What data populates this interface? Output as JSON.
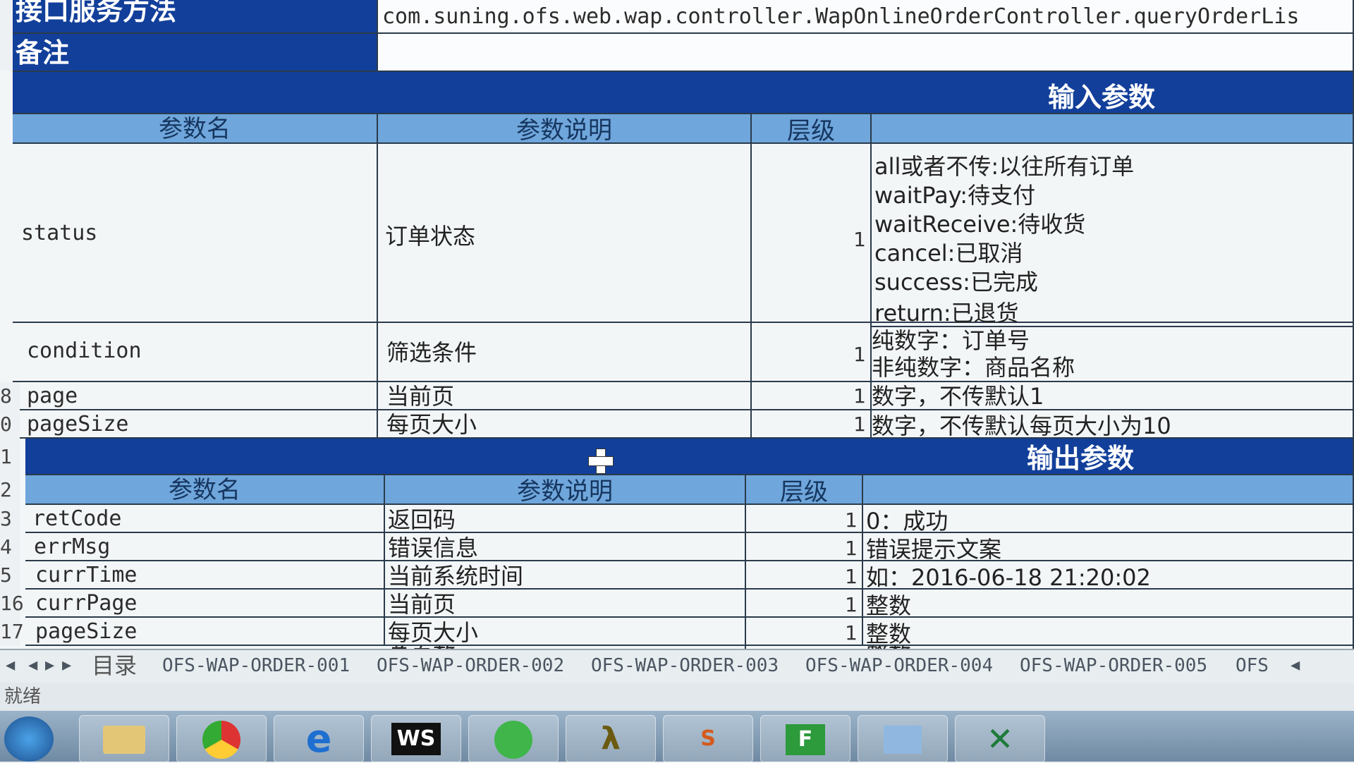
{
  "top": {
    "method_label": "接口服务方法",
    "method_value": "com.suning.ofs.web.wap.controller.WapOnlineOrderController.queryOrderLis",
    "remark_label": "备注"
  },
  "input_section": {
    "title": "输入参数",
    "headers": [
      "参数名",
      "参数说明",
      "层级",
      ""
    ],
    "rows": [
      {
        "rownum": "",
        "name": "status",
        "desc": "订单状态",
        "level": "1",
        "lines": [
          "all或者不传:以往所有订单",
          "waitPay:待支付",
          "waitReceive:待收货",
          "cancel:已取消",
          "success:已完成",
          "return:已退货"
        ]
      },
      {
        "rownum": "",
        "name": "condition",
        "desc": "筛选条件",
        "level": "1",
        "lines": [
          "纯数字：订单号",
          "非纯数字：商品名称"
        ]
      },
      {
        "rownum": "8",
        "name": "page",
        "desc": "当前页",
        "level": "1",
        "lines": [
          "数字，不传默认1"
        ]
      },
      {
        "rownum": "0",
        "name": "pageSize",
        "desc": "每页大小",
        "level": "1",
        "lines": [
          "数字，不传默认每页大小为10"
        ]
      }
    ]
  },
  "output_section": {
    "rownum": "1",
    "title": "输出参数",
    "header_rownum": "2",
    "headers": [
      "参数名",
      "参数说明",
      "层级",
      ""
    ],
    "rows": [
      {
        "rownum": "3",
        "name": "retCode",
        "desc": "返回码",
        "level": "1",
        "note": "0：成功"
      },
      {
        "rownum": "4",
        "name": "errMsg",
        "desc": "错误信息",
        "level": "1",
        "note": "错误提示文案"
      },
      {
        "rownum": "5",
        "name": "currTime",
        "desc": "当前系统时间",
        "level": "1",
        "note": "如：2016-06-18 21:20:02"
      },
      {
        "rownum": "16",
        "name": "currPage",
        "desc": "当前页",
        "level": "1",
        "note": "整数"
      },
      {
        "rownum": "17",
        "name": "pageSize",
        "desc": "每页大小",
        "level": "1",
        "note": "整数"
      }
    ],
    "partial_desc": "总页数",
    "partial_note": "整数"
  },
  "sheet_tabs": [
    "目录",
    "OFS-WAP-ORDER-001",
    "OFS-WAP-ORDER-002",
    "OFS-WAP-ORDER-003",
    "OFS-WAP-ORDER-004",
    "OFS-WAP-ORDER-005",
    "OFS"
  ],
  "status_bar": "就绪",
  "taskbar": {
    "ws_label": "WS",
    "s_label": "S",
    "f_label": "F"
  },
  "colors": {
    "dark_header": "#123f9a",
    "column_header": "#6fa6dc",
    "sheet_bg": "#f3f6f7"
  },
  "icons": [
    "windows-start-icon",
    "file-explorer-icon",
    "chrome-icon",
    "ie-icon",
    "webstorm-icon",
    "green-app-icon",
    "lambda-app-icon",
    "sublime-icon",
    "green-f-icon",
    "blue-app-icon",
    "excel-icon",
    "plus-cursor-icon"
  ]
}
